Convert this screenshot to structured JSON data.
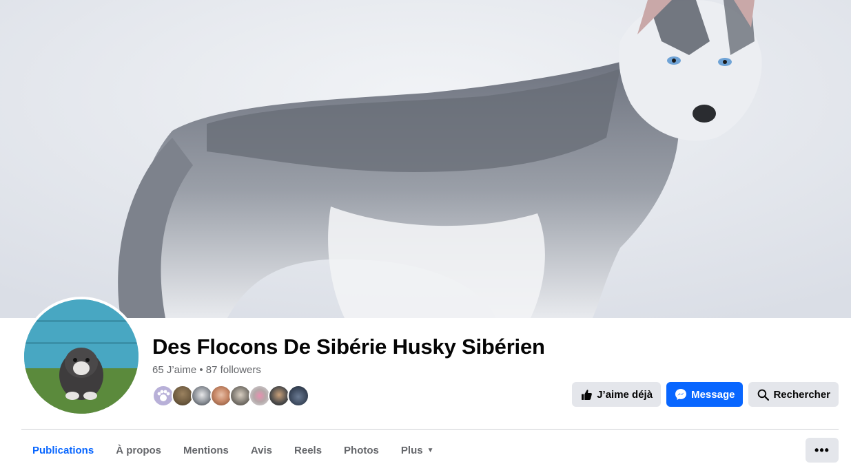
{
  "page": {
    "name": "Des Flocons De Sibérie Husky Sibérien",
    "stats": "65 J’aime • 87 followers"
  },
  "cover": {
    "subject": "siberian-husky-cover-photo"
  },
  "avatar": {
    "subject": "husky-puppy-profile-photo"
  },
  "friends": {
    "avatars": [
      "paw-avatar",
      "dog-avatar-1",
      "husky-avatar",
      "woman-avatar-1",
      "woman-avatar-2",
      "woman-avatar-3",
      "man-avatar",
      "group-avatar"
    ],
    "colors": [
      "#b8b0d8",
      "#6d5a3f",
      "#8a8f96",
      "#c98a6a",
      "#7f7a72",
      "#b4a8a8",
      "#4a4a4a",
      "#3d4a5e"
    ]
  },
  "actions": {
    "like_label": "J’aime déjà",
    "message_label": "Message",
    "search_label": "Rechercher"
  },
  "tabs": [
    {
      "label": "Publications",
      "active": true
    },
    {
      "label": "À propos"
    },
    {
      "label": "Mentions"
    },
    {
      "label": "Avis"
    },
    {
      "label": "Reels"
    },
    {
      "label": "Photos"
    },
    {
      "label": "Plus"
    }
  ],
  "more_menu": {
    "icon": "ellipsis-icon"
  },
  "colors": {
    "accent": "#0866ff",
    "text_primary": "#050505",
    "text_secondary": "#65676b",
    "button_grey": "#e4e6eb"
  }
}
